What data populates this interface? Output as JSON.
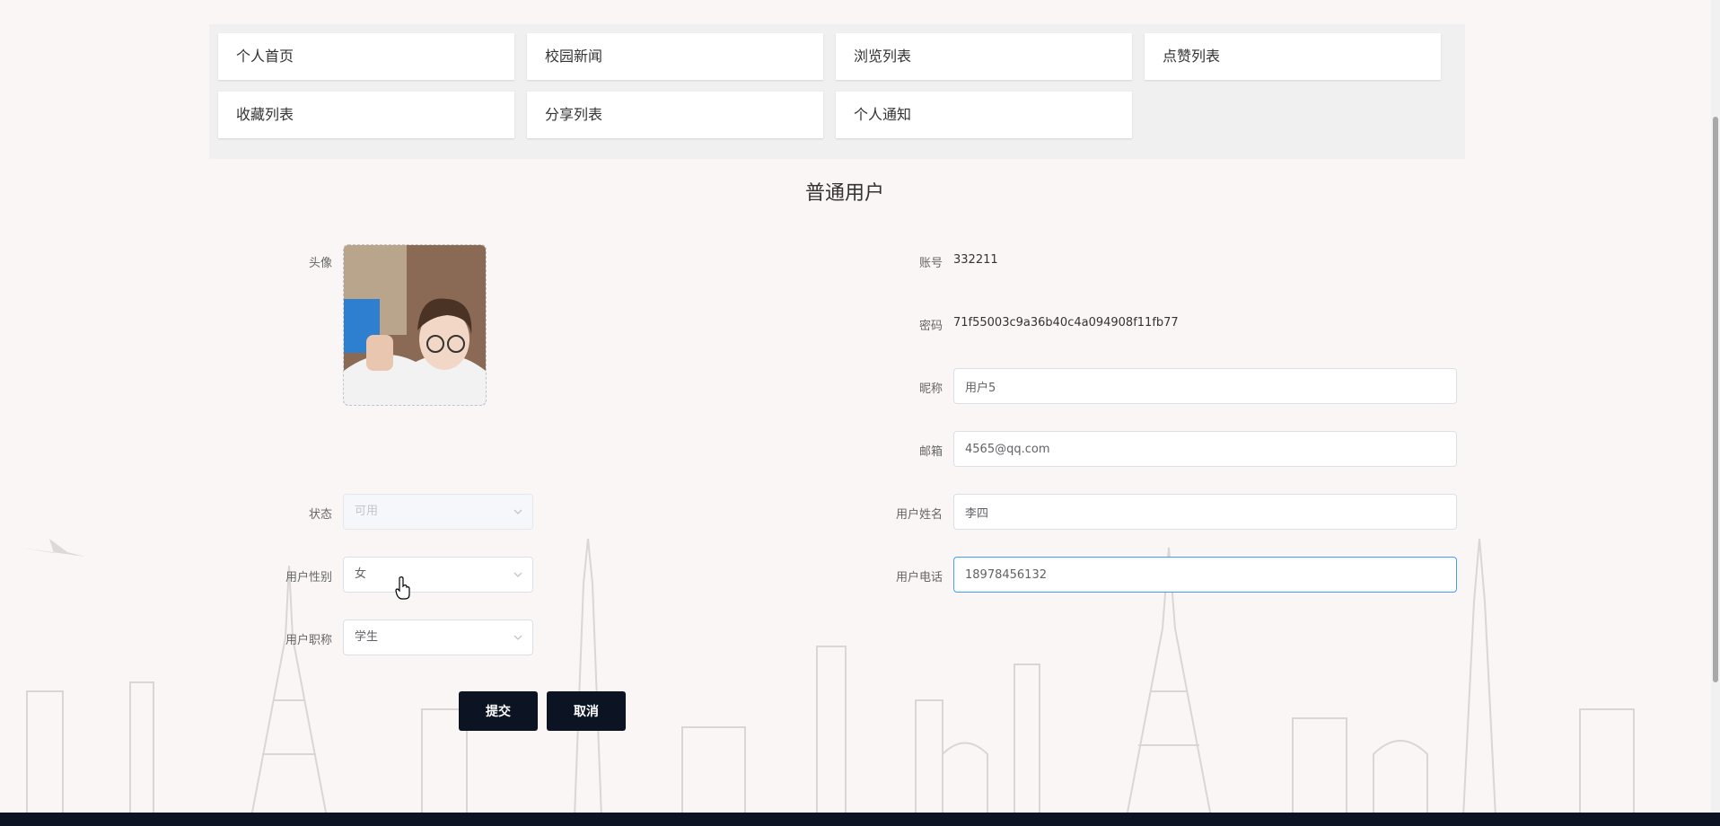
{
  "nav": {
    "items": [
      "个人首页",
      "校园新闻",
      "浏览列表",
      "点赞列表",
      "收藏列表",
      "分享列表",
      "个人通知"
    ]
  },
  "page_title": "普通用户",
  "form": {
    "avatar_label": "头像",
    "account_label": "账号",
    "account_value": "332211",
    "password_label": "密码",
    "password_value": "71f55003c9a36b40c4a094908f11fb77",
    "nickname_label": "昵称",
    "nickname_value": "用户5",
    "email_label": "邮箱",
    "email_value": "4565@qq.com",
    "status_label": "状态",
    "status_value": "可用",
    "realname_label": "用户姓名",
    "realname_value": "李四",
    "gender_label": "用户性别",
    "gender_value": "女",
    "phone_label": "用户电话",
    "phone_value": "18978456132",
    "title_label": "用户职称",
    "title_value": "学生"
  },
  "buttons": {
    "submit": "提交",
    "cancel": "取消"
  },
  "colors": {
    "primary_dark": "#0c1424",
    "focus_border": "#409eff",
    "page_bg": "#f9f6f5"
  }
}
